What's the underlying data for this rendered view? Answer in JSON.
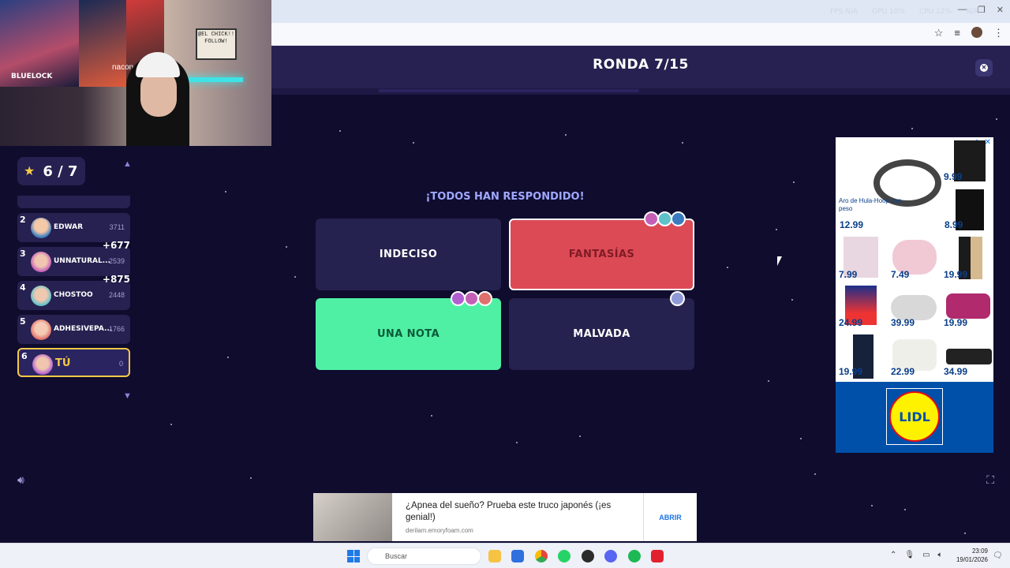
{
  "browser": {
    "overlay_stats": [
      "FPS N/A",
      "GPU 10%",
      "CPU 12%",
      "N/A"
    ],
    "window_buttons": [
      "—",
      "❐",
      "✕"
    ],
    "omni_icons": [
      "star-icon",
      "tab-search-icon",
      "profile-icon",
      "menu-icon"
    ]
  },
  "webcam": {
    "sign_text": "@EL CHICK!! FOLLOW!",
    "chair_brand": "nacon",
    "poster_text": "BLUELOCK"
  },
  "game": {
    "round_title": "RONDA 7/15",
    "all_answered": "¡TODOS HAN RESPONDIDO!",
    "answers": [
      {
        "label": "INDECISO",
        "style": "dark"
      },
      {
        "label": "FANTASÍAS",
        "style": "red",
        "color": "#dc4a56"
      },
      {
        "label": "UNA NOTA",
        "style": "green",
        "color": "#4ff0a4"
      },
      {
        "label": "MALVADA",
        "style": "dark"
      }
    ]
  },
  "leaderboard": {
    "score": "6 / 7",
    "rows": [
      {
        "rank": "2",
        "name": "EDWAR",
        "points": "3711",
        "gain": ""
      },
      {
        "rank": "3",
        "name": "UNNATURAL...",
        "points": "2539",
        "gain": "+677"
      },
      {
        "rank": "4",
        "name": "CHOSTOO",
        "points": "2448",
        "gain": "+875"
      },
      {
        "rank": "5",
        "name": "ADHESIVEPA...",
        "points": "1766",
        "gain": ""
      },
      {
        "rank": "6",
        "name": "TÚ",
        "points": "0",
        "gain": ""
      }
    ]
  },
  "ad_right": {
    "close": "▷ ✕",
    "caption": "Aro de Hula-Hoop con peso",
    "prices": [
      "9.99",
      "12.99",
      "8.99",
      "7.99",
      "7.49",
      "19.99",
      "24.99",
      "39.99",
      "19.99",
      "19.99",
      "22.99",
      "34.99"
    ],
    "brand": "LIDL"
  },
  "ad_bottom": {
    "title": "¿Apnea del sueño? Prueba este truco japonés (¡es genial!)",
    "domain": "derilam.emoryfoam.com",
    "cta": "ABRIR"
  },
  "taskbar": {
    "search_placeholder": "Buscar",
    "time": "23:09",
    "date": "19/01/2026"
  }
}
